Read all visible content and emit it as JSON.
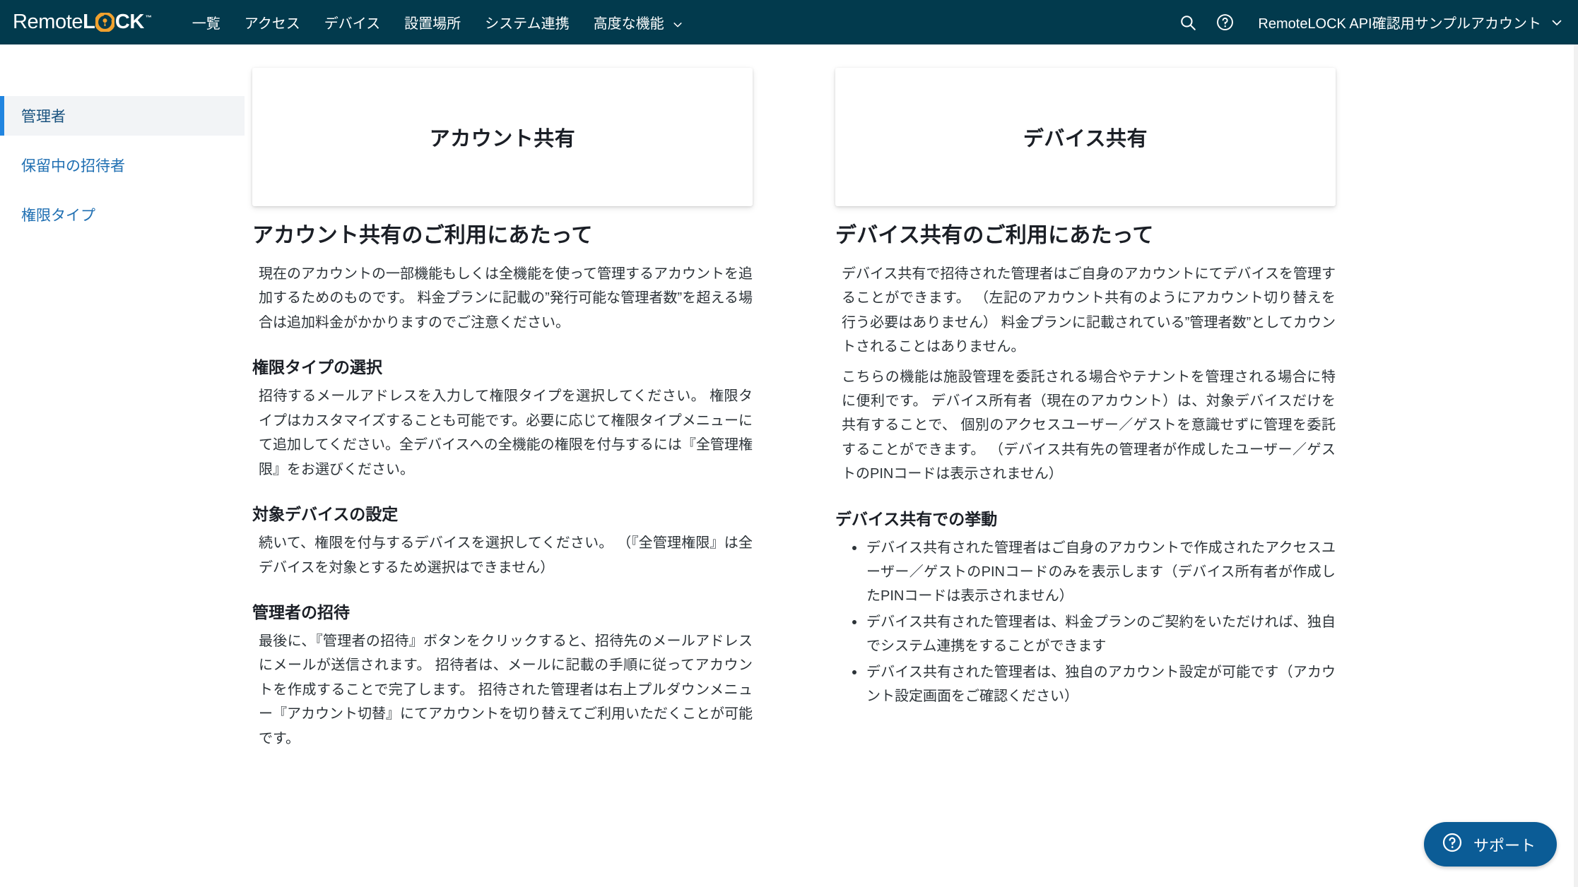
{
  "header": {
    "logo": {
      "part1": "Remote",
      "part2": "L",
      "part3": "CK",
      "trademark": "™",
      "o_icon": "lock-keyhole-icon",
      "accent_color": "#f0a12e",
      "bar_color": "#023a4d"
    },
    "nav_items": [
      {
        "label": "一覧",
        "name": "nav-item-overview",
        "has_chevron": false
      },
      {
        "label": "アクセス",
        "name": "nav-item-access",
        "has_chevron": false
      },
      {
        "label": "デバイス",
        "name": "nav-item-devices",
        "has_chevron": false
      },
      {
        "label": "設置場所",
        "name": "nav-item-locations",
        "has_chevron": false
      },
      {
        "label": "システム連携",
        "name": "nav-item-integrations",
        "has_chevron": false
      },
      {
        "label": "高度な機能",
        "name": "nav-item-advanced",
        "has_chevron": true
      }
    ],
    "search_icon": "search-icon",
    "help_icon": "question-circle-icon",
    "account_name": "RemoteLOCK API確認用サンプルアカウント",
    "account_chevron_icon": "chevron-down-icon"
  },
  "sidebar": {
    "items": [
      {
        "label": "管理者",
        "name": "sidebar-item-administrators",
        "active": true
      },
      {
        "label": "保留中の招待者",
        "name": "sidebar-item-pending-invites",
        "active": false
      },
      {
        "label": "権限タイプ",
        "name": "sidebar-item-permission-types",
        "active": false
      }
    ],
    "active_accent_color": "#2185e0",
    "active_bg_color": "#f2f4f6",
    "link_color": "#1f6fb2"
  },
  "main": {
    "left": {
      "card_title": "アカウント共有",
      "heading": "アカウント共有のご利用にあたって",
      "intro": "現在のアカウントの一部機能もしくは全機能を使って管理するアカウントを追加するためのものです。 料金プランに記載の”発行可能な管理者数”を超える場合は追加料金がかかりますのでご注意ください。",
      "sections": [
        {
          "heading": "権限タイプの選択",
          "body": "招待するメールアドレスを入力して権限タイプを選択してください。 権限タイプはカスタマイズすることも可能です。必要に応じて権限タイプメニューにて追加してください。全デバイスへの全機能の権限を付与するには『全管理権限』をお選びください。"
        },
        {
          "heading": "対象デバイスの設定",
          "body": "続いて、権限を付与するデバイスを選択してください。 （『全管理権限』は全デバイスを対象とするため選択はできません）"
        },
        {
          "heading": "管理者の招待",
          "body": "最後に、『管理者の招待』ボタンをクリックすると、招待先のメールアドレスにメールが送信されます。 招待者は、メールに記載の手順に従ってアカウントを作成することで完了します。 招待された管理者は右上プルダウンメニュー『アカウント切替』にてアカウントを切り替えてご利用いただくことが可能です。"
        }
      ]
    },
    "right": {
      "card_title": "デバイス共有",
      "heading": "デバイス共有のご利用にあたって",
      "para1": "デバイス共有で招待された管理者はご自身のアカウントにてデバイスを管理することができます。 （左記のアカウント共有のようにアカウント切り替えを行う必要はありません） 料金プランに記載されている”管理者数”としてカウントされることはありません。",
      "para2": "こちらの機能は施設管理を委託される場合やテナントを管理される場合に特に便利です。 デバイス所有者（現在のアカウント）は、対象デバイスだけを共有することで、 個別のアクセスユーザー／ゲストを意識せずに管理を委託することができます。 （デバイス共有先の管理者が作成したユーザー／ゲストのPINコードは表示されません）",
      "behavior_heading": "デバイス共有での挙動",
      "bullets": [
        "デバイス共有された管理者はご自身のアカウントで作成されたアクセスユーザー／ゲストのPINコードのみを表示します（デバイス所有者が作成したPINコードは表示されません）",
        "デバイス共有された管理者は、料金プランのご契約をいただければ、独自でシステム連携をすることができます",
        "デバイス共有された管理者は、独自のアカウント設定が可能です（アカウント設定画面をご確認ください）"
      ]
    }
  },
  "support": {
    "label": "サポート",
    "icon": "question-circle-icon",
    "background_color": "#0b5c96"
  }
}
